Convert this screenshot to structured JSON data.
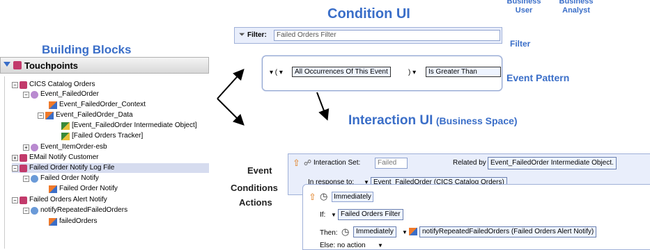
{
  "headings": {
    "building_blocks": "Building Blocks",
    "condition_ui": "Condition UI",
    "interaction_ui": "Interaction UI",
    "interaction_ui_sub": "(Business Space)",
    "business_user": "Business User",
    "business_analyst": "Business Analyst",
    "filter": "Filter",
    "event_pattern": "Event Pattern"
  },
  "tree": {
    "header": "Touchpoints",
    "items": [
      "CICS Catalog Orders",
      "Event_FailedOrder",
      "Event_FailedOrder_Context",
      "Event_FailedOrder_Data",
      "[Event_FailedOrder Intermediate Object]",
      "[Failed Orders Tracker]",
      "Event_ItemOrder-esb",
      "EMail Notify Customer",
      "Failed Order Notify Log File",
      "Failed Order Notify",
      "Failed Order Notify",
      "Failed Orders Alert Notify",
      "notifyRepeatedFailedOrders",
      "failedOrders"
    ]
  },
  "condition": {
    "filter_label": "Filter:",
    "filter_value": "Failed Orders Filter",
    "occurrence": "All Occurrences Of This Event",
    "operator": "Is Greater Than"
  },
  "interaction": {
    "set_label": "Interaction Set:",
    "set_value": "Failed",
    "related_label": "Related by",
    "related_value": "Event_FailedOrder Intermediate Object.",
    "response_label": "In response to:",
    "response_value": "Event_FailedOrder (CICS Catalog Orders)",
    "timing": "Immediately",
    "if_label": "If:",
    "if_value": "Failed Orders Filter",
    "then_label": "Then:",
    "then_timing": "Immediately",
    "then_action": "notifyRepeatedFailedOrders (Failed Orders Alert Notify)",
    "else_text": "Else: no action"
  },
  "side_labels": {
    "event": "Event",
    "conditions": "Conditions",
    "actions": "Actions"
  },
  "colors": {
    "heading": "#3a6ec8",
    "panel": "#e9eefb",
    "selected_row": "#d6dcef"
  }
}
